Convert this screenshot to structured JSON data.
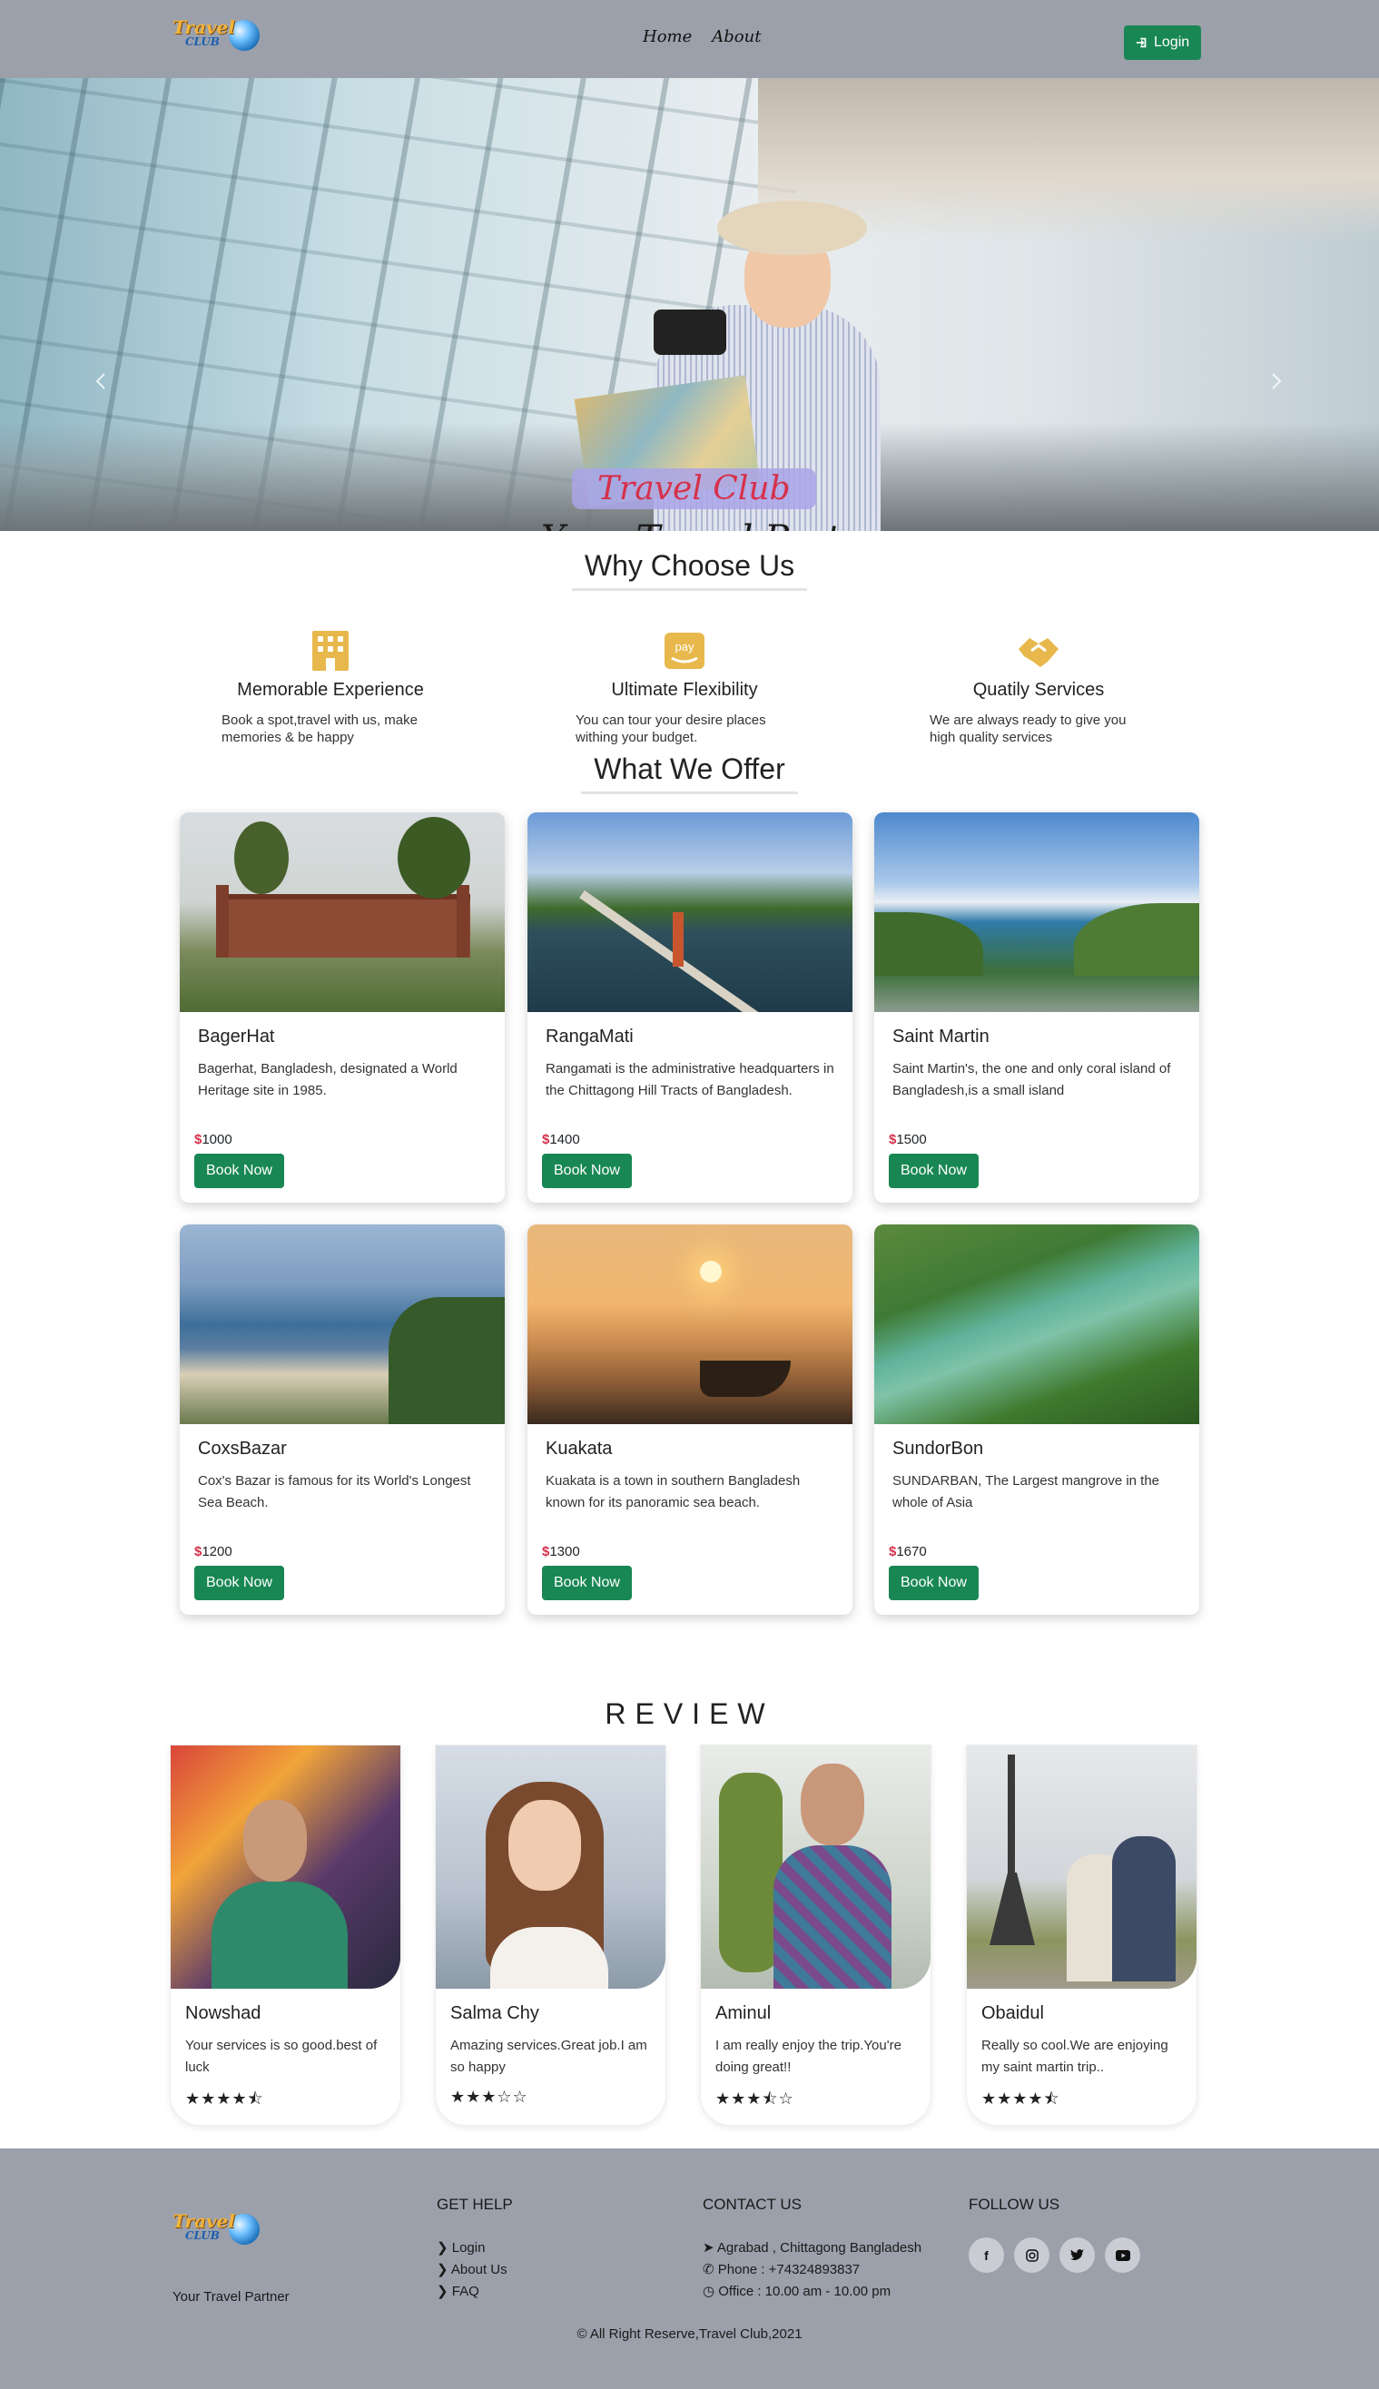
{
  "nav": {
    "logo_top": "Travel",
    "logo_bottom": "CLUB",
    "links": [
      "Home",
      "About"
    ],
    "login_label": "Login"
  },
  "hero": {
    "brand": "Travel Club",
    "tagline": "Your Travel Partner"
  },
  "why": {
    "title": "Why Choose Us",
    "features": [
      {
        "icon": "building-icon",
        "title": "Memorable Experience",
        "text": "Book a spot,travel with us, make memories & be happy"
      },
      {
        "icon": "pay-icon",
        "title": "Ultimate Flexibility",
        "text": "You can tour your desire places withing your budget."
      },
      {
        "icon": "handshake-icon",
        "title": "Quatily Services",
        "text": "We are always ready to give you high quality services"
      }
    ],
    "accent_color": "#e8b84c"
  },
  "offer": {
    "title": "What We Offer",
    "currency": "$",
    "book_label": "Book Now",
    "places": [
      {
        "name": "BagerHat",
        "text": "Bagerhat, Bangladesh, designated a World Heritage site in 1985.",
        "price": "1000"
      },
      {
        "name": "RangaMati",
        "text": "Rangamati is the administrative headquarters in the Chittagong Hill Tracts of Bangladesh.",
        "price": "1400"
      },
      {
        "name": "Saint Martin",
        "text": "Saint Martin's, the one and only coral island of Bangladesh,is a small island",
        "price": "1500"
      },
      {
        "name": "CoxsBazar",
        "text": "Cox's Bazar is famous for its World's Longest Sea Beach.",
        "price": "1200"
      },
      {
        "name": "Kuakata",
        "text": "Kuakata is a town in southern Bangladesh known for its panoramic sea beach.",
        "price": "1300"
      },
      {
        "name": "SundorBon",
        "text": "SUNDARBAN, The Largest mangrove in the whole of Asia",
        "price": "1670"
      }
    ]
  },
  "reviews": {
    "title": "REVIEW",
    "items": [
      {
        "name": "Nowshad",
        "text": "Your services is so good.best of luck",
        "stars": "★★★★⯪"
      },
      {
        "name": "Salma Chy",
        "text": "Amazing services.Great job.I am so happy",
        "stars": "★★★☆☆"
      },
      {
        "name": "Aminul",
        "text": "I am really enjoy the trip.You're doing great!!",
        "stars": "★★★⯪☆"
      },
      {
        "name": "Obaidul",
        "text": "Really so cool.We are enjoying my saint martin trip..",
        "stars": "★★★★⯪"
      }
    ]
  },
  "footer": {
    "tagline": "Your Travel Partner",
    "help_title": "GET HELP",
    "help_links": [
      "Login",
      "About Us",
      "FAQ"
    ],
    "contact_title": "CONTACT US",
    "contact": [
      "Agrabad , Chittagong Bangladesh",
      "Phone : +74324893837",
      "Office : 10.00 am - 10.00 pm"
    ],
    "follow_title": "FOLLOW US",
    "social": [
      "facebook-icon",
      "instagram-icon",
      "twitter-icon",
      "youtube-icon"
    ],
    "copyright": "© All Right Reserve,Travel Club,2021"
  },
  "colors": {
    "nav_bg": "#9ba0ab",
    "button_green": "#198754",
    "price_red": "#d6304b"
  }
}
